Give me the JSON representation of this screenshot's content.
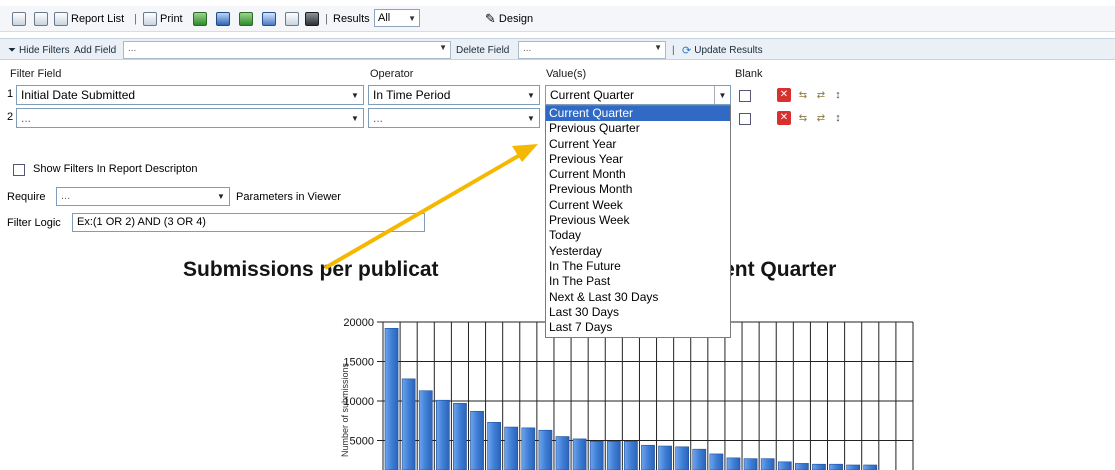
{
  "toolbar": {
    "report_list": "Report List",
    "print": "Print",
    "results_label": "Results",
    "results_value": "All",
    "design": "Design",
    "sep": "|"
  },
  "filterbar": {
    "hide_filters": "Hide Filters",
    "add_field": "Add Field",
    "add_field_value": "...",
    "delete_field": "Delete Field",
    "delete_field_value": "...",
    "update_results": "Update Results"
  },
  "filters": {
    "headers": {
      "field": "Filter Field",
      "operator": "Operator",
      "values": "Value(s)",
      "blank": "Blank"
    },
    "rows": [
      {
        "num": "1",
        "field": "Initial Date Submitted",
        "operator": "In Time Period",
        "value": "Current Quarter"
      },
      {
        "num": "2",
        "field": "...",
        "operator": "...",
        "value": ""
      }
    ]
  },
  "options": {
    "show_filters": "Show Filters In Report Descripton",
    "require_label": "Require",
    "require_value": "...",
    "parameters": "Parameters in Viewer",
    "filter_logic_label": "Filter Logic",
    "filter_logic_placeholder": "Ex:(1 OR 2) AND (3 OR 4)"
  },
  "dropdown": {
    "options": [
      "Current Quarter",
      "Previous Quarter",
      "Current Year",
      "Previous Year",
      "Current Month",
      "Previous Month",
      "Current Week",
      "Previous Week",
      "Today",
      "Yesterday",
      "In The Future",
      "In The Past",
      "Next & Last 30 Days",
      "Last 30 Days",
      "Last 7 Days"
    ],
    "selected_index": 0
  },
  "report_title": {
    "left": "Submissions per publicat",
    "right": "eriod: Current Quarter"
  },
  "chart_data": {
    "type": "bar",
    "ylabel": "Number of submissions",
    "ylim": [
      0,
      20000
    ],
    "yticks": [
      20000,
      15000,
      10000,
      5000
    ],
    "ytick_labels": [
      "20000",
      "15000",
      "10000",
      "5000"
    ],
    "values": [
      19200,
      12800,
      11300,
      10100,
      9700,
      8700,
      7300,
      6700,
      6600,
      6300,
      5500,
      5200,
      4900,
      4900,
      4900,
      4400,
      4300,
      4200,
      3900,
      3300,
      2800,
      2700,
      2700,
      2300,
      2100,
      2000,
      2000,
      1900,
      1900
    ],
    "grid": true,
    "bar_color": "#3f7fd6"
  },
  "colors": {
    "accent_arrow": "#f5b800",
    "selection": "#316ac5"
  }
}
